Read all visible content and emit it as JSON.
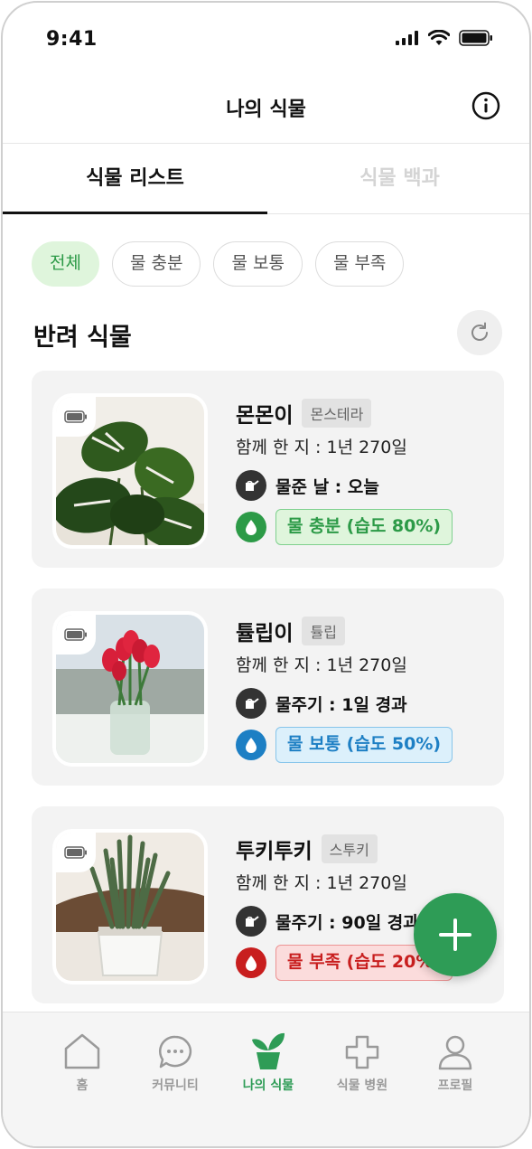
{
  "status_bar": {
    "time": "9:41"
  },
  "header": {
    "title": "나의 식물",
    "info_icon": "info-icon"
  },
  "tabs": [
    {
      "label": "식물 리스트",
      "active": true
    },
    {
      "label": "식물 백과",
      "active": false
    }
  ],
  "filters": [
    {
      "label": "전체",
      "active": true
    },
    {
      "label": "물 충분",
      "active": false
    },
    {
      "label": "물 보통",
      "active": false
    },
    {
      "label": "물 부족",
      "active": false
    }
  ],
  "section": {
    "title": "반려 식물",
    "refresh_icon": "refresh-icon"
  },
  "plants": [
    {
      "name": "몬몬이",
      "species": "몬스테라",
      "together": "함께 한 지 : 1년 270일",
      "water": "물준 날 : 오늘",
      "status": "물 충분 (습도 80%)",
      "status_level": "good",
      "status_color": "#2c9a47"
    },
    {
      "name": "튤립이",
      "species": "튤립",
      "together": "함께 한 지 : 1년 270일",
      "water": "물주기 : 1일 경과",
      "status": "물 보통 (습도 50%)",
      "status_level": "mid",
      "status_color": "#1d7fc4"
    },
    {
      "name": "투키투키",
      "species": "스투키",
      "together": "함께 한 지 : 1년 270일",
      "water": "물주기 : 90일 경과",
      "status": "물 부족 (습도 20%)",
      "status_level": "low",
      "status_color": "#c81e1e"
    }
  ],
  "fab": {
    "icon": "plus-icon"
  },
  "bottom_nav": [
    {
      "label": "홈",
      "icon": "home-icon",
      "active": false
    },
    {
      "label": "커뮤니티",
      "icon": "chat-icon",
      "active": false
    },
    {
      "label": "나의 식물",
      "icon": "plant-icon",
      "active": true
    },
    {
      "label": "식물 병원",
      "icon": "cross-icon",
      "active": false
    },
    {
      "label": "프로필",
      "icon": "user-icon",
      "active": false
    }
  ],
  "colors": {
    "accent": "#2e9c56",
    "good": "#2c9a47",
    "mid": "#1d7fc4",
    "low": "#c81e1e"
  }
}
